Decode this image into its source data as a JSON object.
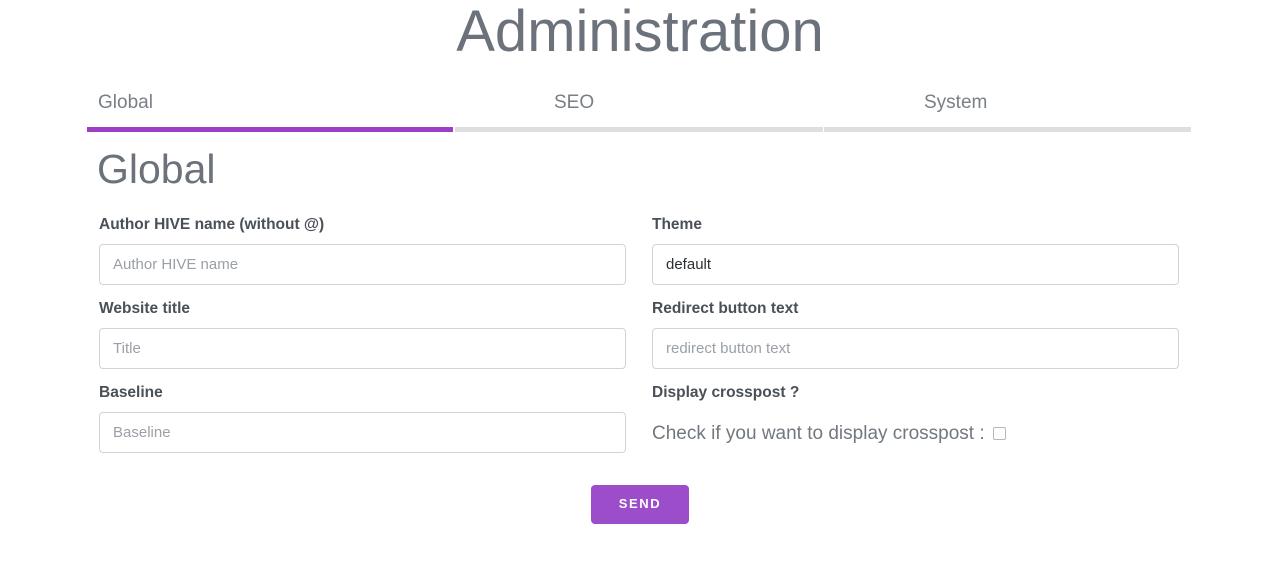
{
  "header": {
    "title": "Administration"
  },
  "tabs": [
    {
      "label": "Global",
      "active": true
    },
    {
      "label": "SEO",
      "active": false
    },
    {
      "label": "System",
      "active": false
    }
  ],
  "section": {
    "heading": "Global"
  },
  "form": {
    "fields": [
      {
        "name": "author-hive-name",
        "label": "Author HIVE name (without @)",
        "placeholder": "Author HIVE name",
        "value": ""
      },
      {
        "name": "theme",
        "label": "Theme",
        "placeholder": "",
        "value": "default"
      },
      {
        "name": "website-title",
        "label": "Website title",
        "placeholder": "Title",
        "value": ""
      },
      {
        "name": "redirect-button-text",
        "label": "Redirect button text",
        "placeholder": "redirect button text",
        "value": ""
      },
      {
        "name": "baseline",
        "label": "Baseline",
        "placeholder": "Baseline",
        "value": ""
      }
    ],
    "crosspost": {
      "label": "Display crosspost ?",
      "caption": "Check if you want to display crosspost :",
      "checked": false
    },
    "submit_label": "SEND"
  },
  "colors": {
    "accent": "#9b4dca",
    "tab_active_underline": "#9c3fc4",
    "tab_inactive_underline": "#dededf",
    "title_text": "#6b727b",
    "label_text": "#4a5057",
    "placeholder_text": "#9aa0a6",
    "input_border": "#ced4da",
    "background": "#ffffff"
  }
}
